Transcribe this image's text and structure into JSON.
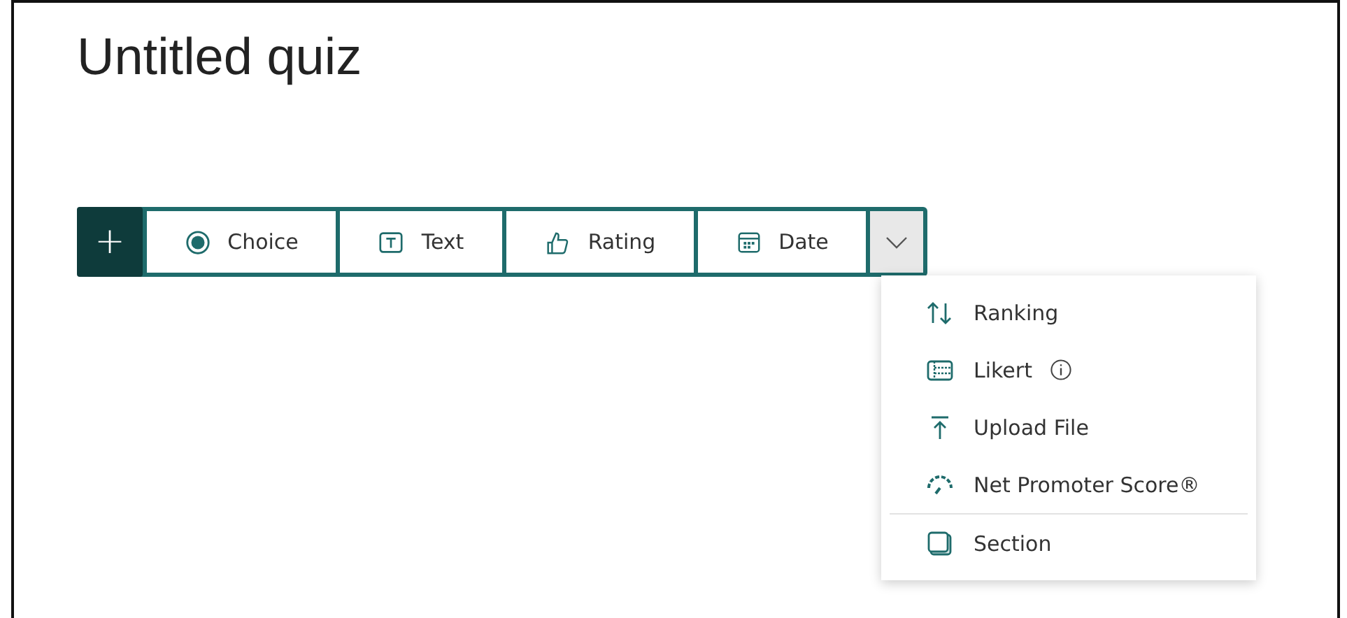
{
  "title": "Untitled quiz",
  "toolbar": {
    "add_label": "+",
    "items": [
      {
        "kind": "choice",
        "label": "Choice"
      },
      {
        "kind": "text",
        "label": "Text"
      },
      {
        "kind": "rating",
        "label": "Rating"
      },
      {
        "kind": "date",
        "label": "Date"
      }
    ],
    "more_expanded": true
  },
  "menu": [
    {
      "kind": "ranking",
      "label": "Ranking",
      "info": false
    },
    {
      "kind": "likert",
      "label": "Likert",
      "info": true
    },
    {
      "kind": "upload",
      "label": "Upload File",
      "info": false
    },
    {
      "kind": "nps",
      "label": "Net Promoter Score®",
      "info": false
    },
    {
      "kind": "section",
      "label": "Section",
      "info": false
    }
  ]
}
